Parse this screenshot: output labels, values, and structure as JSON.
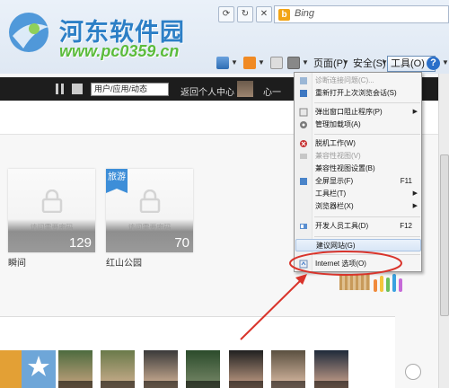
{
  "browser": {
    "search_placeholder": "Bing",
    "commands": {
      "page": "页面(P)",
      "safety": "安全(S)",
      "tools": "工具(O)"
    }
  },
  "watermark": {
    "name": "河东软件园",
    "url": "www.pc0359.cn"
  },
  "site": {
    "search_value": "用户/应用/动态",
    "home_link": "返回个人中心",
    "user_name": "心一"
  },
  "cards": [
    {
      "title": "瞬间",
      "lock_text": "访问需要密码",
      "count": "129",
      "tag": ""
    },
    {
      "title": "红山公园",
      "lock_text": "访问需要密码",
      "count": "70",
      "tag": "旅游"
    }
  ],
  "tools_menu": {
    "items": [
      {
        "label": "诊断连接问题(C)...",
        "disabled": true
      },
      {
        "label": "重新打开上次浏览会话(S)"
      },
      {
        "label": "弹出窗口阻止程序(P)",
        "submenu": true
      },
      {
        "label": "管理加载项(A)"
      },
      {
        "label": "脱机工作(W)"
      },
      {
        "label": "兼容性视图(V)",
        "disabled": true
      },
      {
        "label": "兼容性视图设置(B)"
      },
      {
        "label": "全屏显示(F)",
        "shortcut": "F11"
      },
      {
        "label": "工具栏(T)",
        "submenu": true
      },
      {
        "label": "浏览器栏(X)",
        "submenu": true
      },
      {
        "label": "开发人员工具(D)",
        "shortcut": "F12"
      },
      {
        "label": "建议网站(G)"
      },
      {
        "label": "Internet 选项(O)"
      }
    ]
  },
  "colors": {
    "annotation_red": "#d9342b",
    "menu_highlight": "#d8e6f6",
    "topbar": "#1d1d1d"
  }
}
